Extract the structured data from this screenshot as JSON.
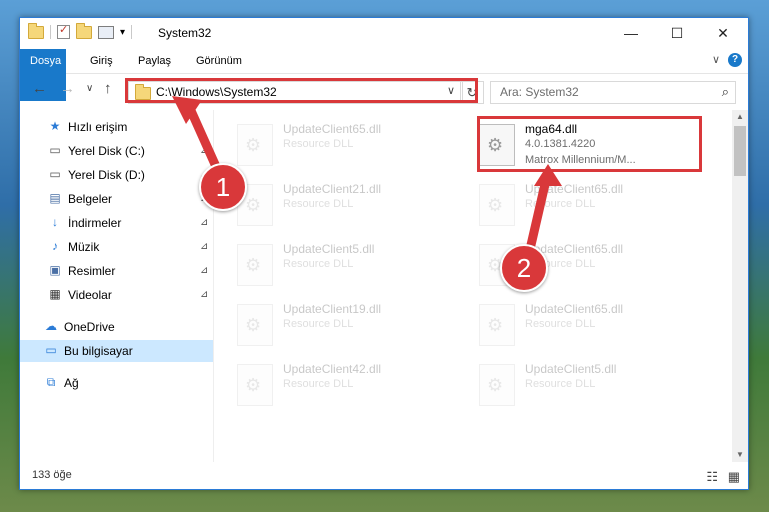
{
  "window": {
    "title": "System32",
    "minimize_glyph": "—",
    "maximize_glyph": "☐",
    "close_glyph": "✕"
  },
  "ribbon": {
    "tabs": [
      "Dosya",
      "Giriş",
      "Paylaş",
      "Görünüm"
    ],
    "help_glyph": "?",
    "expand_glyph": "∨"
  },
  "navigation": {
    "back_glyph": "←",
    "forward_glyph": "→",
    "recent_glyph": "∨",
    "up_glyph": "↑",
    "address": "C:\\Windows\\System32",
    "refresh_glyph": "↻",
    "search_placeholder": "Ara: System32",
    "search_glyph": "⌕"
  },
  "sidebar": {
    "items": [
      {
        "label": "Hızlı erişim",
        "icon": "star-icon",
        "glyph": "★",
        "color": "#2b7bd6",
        "pinned": false
      },
      {
        "label": "Yerel Disk (C:)",
        "icon": "drive-icon",
        "glyph": "▭",
        "color": "#555555",
        "pinned": true
      },
      {
        "label": "Yerel Disk (D:)",
        "icon": "drive-icon",
        "glyph": "▭",
        "color": "#555555",
        "pinned": true
      },
      {
        "label": "Belgeler",
        "icon": "documents-icon",
        "glyph": "▤",
        "color": "#4a6fa5",
        "pinned": true
      },
      {
        "label": "İndirmeler",
        "icon": "download-icon",
        "glyph": "↓",
        "color": "#2b7bd6",
        "pinned": true
      },
      {
        "label": "Müzik",
        "icon": "music-icon",
        "glyph": "♪",
        "color": "#2b7bd6",
        "pinned": true
      },
      {
        "label": "Resimler",
        "icon": "pictures-icon",
        "glyph": "▣",
        "color": "#4a6fa5",
        "pinned": true
      },
      {
        "label": "Videolar",
        "icon": "video-icon",
        "glyph": "▦",
        "color": "#333333",
        "pinned": true
      },
      {
        "label": "OneDrive",
        "icon": "cloud-icon",
        "glyph": "☁",
        "color": "#2b7bd6",
        "pinned": false
      },
      {
        "label": "Bu bilgisayar",
        "icon": "computer-icon",
        "glyph": "▭",
        "color": "#2b7bd6",
        "pinned": false,
        "selected": true
      },
      {
        "label": "Ağ",
        "icon": "network-icon",
        "glyph": "⧉",
        "color": "#2b7bd6",
        "pinned": false
      }
    ],
    "pin_glyph": "📌"
  },
  "files": {
    "highlighted": {
      "name": "mga64.dll",
      "version": "4.0.1381.4220",
      "description": "Matrox Millennium/M..."
    },
    "left_column": [
      {
        "name": "UpdateClient65.dll",
        "type": "Resource DLL"
      },
      {
        "name": "UpdateClient21.dll",
        "type": "Resource DLL"
      },
      {
        "name": "UpdateClient5.dll",
        "type": "Resource DLL"
      },
      {
        "name": "UpdateClient19.dll",
        "type": "Resource DLL"
      },
      {
        "name": "UpdateClient42.dll",
        "type": "Resource DLL"
      }
    ],
    "right_column": [
      {
        "name": "UpdateClient65.dll",
        "type": "Resource DLL"
      },
      {
        "name": "UpdateClient65.dll",
        "type": "Resource DLL"
      },
      {
        "name": "UpdateClient65.dll",
        "type": "Resource DLL"
      },
      {
        "name": "UpdateClient5.dll",
        "type": "Resource DLL"
      }
    ]
  },
  "status": {
    "item_count": "133 öğe"
  },
  "annotations": {
    "step1": "1",
    "step2": "2",
    "color": "#d9383a"
  }
}
